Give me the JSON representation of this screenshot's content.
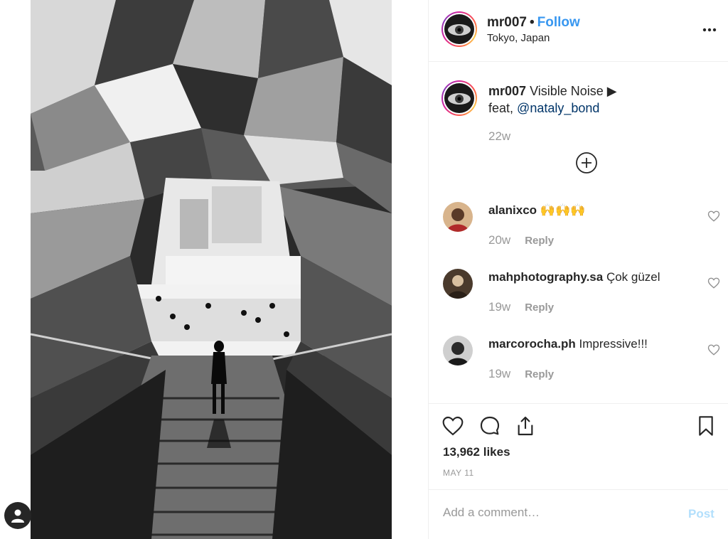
{
  "header": {
    "username": "mr007",
    "separator": "•",
    "follow_label": "Follow",
    "location": "Tokyo, Japan"
  },
  "caption": {
    "username": "mr007",
    "text_line1": "Visible Noise ▶",
    "text_line2_prefix": "feat,",
    "mention": "@nataly_bond",
    "time": "22w"
  },
  "comments": [
    {
      "username": "alanixco",
      "text": "🙌🙌🙌",
      "time": "20w",
      "reply_label": "Reply"
    },
    {
      "username": "mahphotography.sa",
      "text": "Çok güzel",
      "time": "19w",
      "reply_label": "Reply"
    },
    {
      "username": "marcorocha.ph",
      "text": "Impressive!!!",
      "time": "19w",
      "reply_label": "Reply"
    }
  ],
  "post": {
    "likes": "13,962 likes",
    "date": "MAY 11"
  },
  "add_comment": {
    "placeholder": "Add a comment…",
    "post_label": "Post"
  },
  "colors": {
    "link_blue": "#3897f0",
    "mention_blue": "#003569",
    "muted": "#999999",
    "post_disabled": "#b2dffc"
  }
}
